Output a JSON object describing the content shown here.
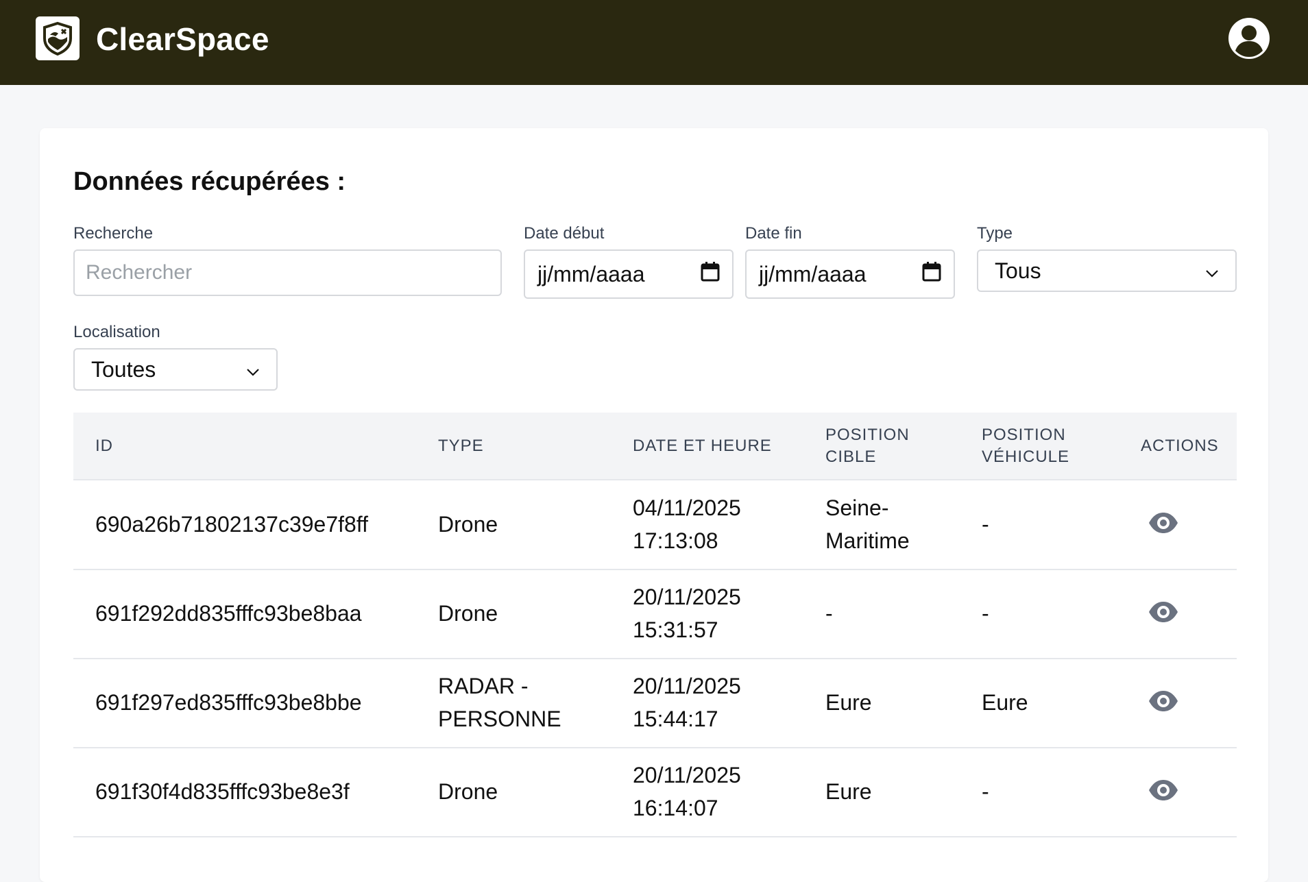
{
  "header": {
    "app_name": "ClearSpace",
    "logo_icon": "shield-logo-icon",
    "user_icon": "user-avatar-icon",
    "background_color": "#2a2810"
  },
  "main": {
    "title": "Données récupérées :",
    "filters": {
      "search": {
        "label": "Recherche",
        "placeholder": "Rechercher",
        "value": ""
      },
      "date_start": {
        "label": "Date début",
        "value": "jj/mm/aaaa",
        "icon": "calendar-icon"
      },
      "date_end": {
        "label": "Date fin",
        "value": "jj/mm/aaaa",
        "icon": "calendar-icon"
      },
      "type": {
        "label": "Type",
        "value": "Tous",
        "icon": "chevron-down-icon"
      },
      "location": {
        "label": "Localisation",
        "value": "Toutes",
        "icon": "chevron-down-icon"
      }
    },
    "table": {
      "columns": [
        "ID",
        "TYPE",
        "DATE ET HEURE",
        "POSITION CIBLE",
        "POSITION VÉHICULE",
        "ACTIONS"
      ],
      "columns_lines": {
        "position_cible": [
          "POSITION",
          "CIBLE"
        ],
        "position_vehicule": [
          "POSITION",
          "VÉHICULE"
        ]
      },
      "rows": [
        {
          "id": "690a26b71802137c39e7f8ff",
          "type_lines": [
            "Drone"
          ],
          "date": "04/11/2025",
          "time": "17:13:08",
          "position_cible_lines": [
            "Seine-",
            "Maritime"
          ],
          "position_vehicule": "-",
          "action_icon": "eye-icon"
        },
        {
          "id": "691f292dd835fffc93be8baa",
          "type_lines": [
            "Drone"
          ],
          "date": "20/11/2025",
          "time": "15:31:57",
          "position_cible_lines": [
            "-"
          ],
          "position_vehicule": "-",
          "action_icon": "eye-icon"
        },
        {
          "id": "691f297ed835fffc93be8bbe",
          "type_lines": [
            "RADAR -",
            "PERSONNE"
          ],
          "date": "20/11/2025",
          "time": "15:44:17",
          "position_cible_lines": [
            "Eure"
          ],
          "position_vehicule": "Eure",
          "action_icon": "eye-icon"
        },
        {
          "id": "691f30f4d835fffc93be8e3f",
          "type_lines": [
            "Drone"
          ],
          "date": "20/11/2025",
          "time": "16:14:07",
          "position_cible_lines": [
            "Eure"
          ],
          "position_vehicule": "-",
          "action_icon": "eye-icon"
        }
      ]
    }
  }
}
